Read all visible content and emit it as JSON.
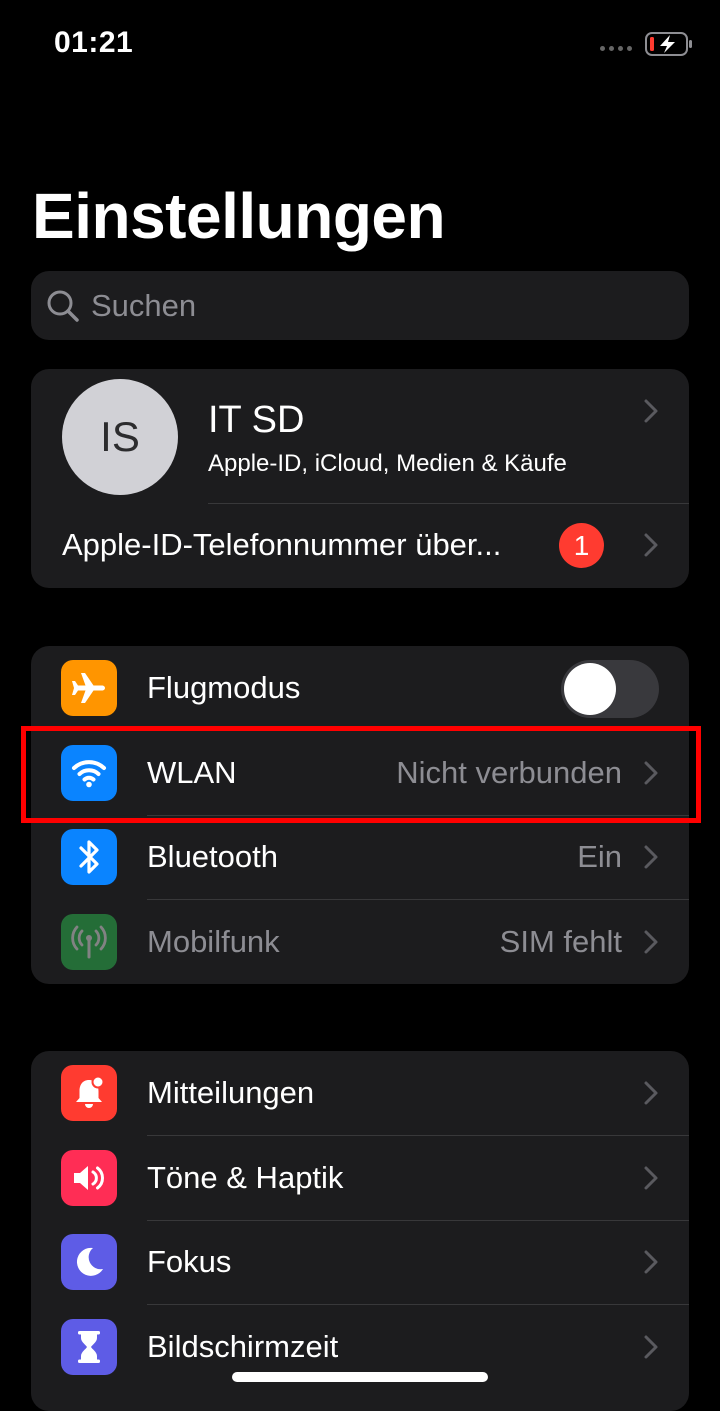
{
  "status_bar": {
    "time": "01:21"
  },
  "header": {
    "title": "Einstellungen"
  },
  "search": {
    "placeholder": "Suchen"
  },
  "profile": {
    "initials": "IS",
    "name": "IT SD",
    "subtitle": "Apple-ID, iCloud, Medien & Käufe",
    "notice_label": "Apple-ID-Telefonnummer über...",
    "notice_badge": "1"
  },
  "connectivity": {
    "items": [
      {
        "label": "Flugmodus",
        "icon": "airplane-icon",
        "color": "#ff9500",
        "toggle_on": false
      },
      {
        "label": "WLAN",
        "value": "Nicht verbunden",
        "icon": "wifi-icon",
        "color": "#0a84ff"
      },
      {
        "label": "Bluetooth",
        "value": "Ein",
        "icon": "bluetooth-icon",
        "color": "#0a84ff"
      },
      {
        "label": "Mobilfunk",
        "value": "SIM fehlt",
        "icon": "antenna-icon",
        "color": "#30d158",
        "disabled": true
      }
    ]
  },
  "general": {
    "items": [
      {
        "label": "Mitteilungen",
        "icon": "notification-bell-icon",
        "color": "#ff3b30"
      },
      {
        "label": "Töne & Haptik",
        "icon": "speaker-icon",
        "color": "#ff2d55"
      },
      {
        "label": "Fokus",
        "icon": "moon-icon",
        "color": "#5e5ce6"
      },
      {
        "label": "Bildschirmzeit",
        "icon": "hourglass-icon",
        "color": "#5e5ce6"
      }
    ]
  },
  "highlight": {
    "target": "WLAN",
    "color": "#ff0000"
  }
}
